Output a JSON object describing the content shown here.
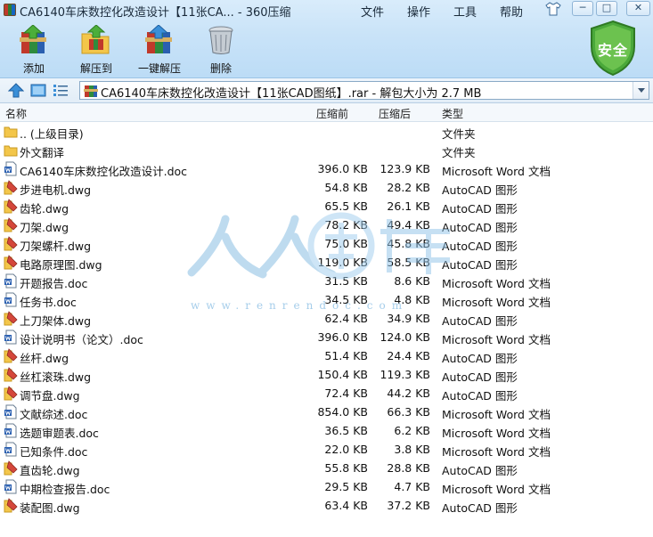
{
  "window": {
    "title": "CA6140车床数控化改造设计【11张CA... - 360压缩"
  },
  "menu": {
    "items": [
      "文件",
      "操作",
      "工具",
      "帮助"
    ]
  },
  "window_controls": {
    "minimize": "─",
    "restore": "□",
    "close": "✕"
  },
  "toolbar": {
    "add_label": "添加",
    "extract_to_label": "解压到",
    "one_click_extract_label": "一键解压",
    "delete_label": "删除",
    "security_badge": "安全"
  },
  "address_bar": {
    "path": "CA6140车床数控化改造设计【11张CAD图纸】.rar - 解包大小为 2.7 MB"
  },
  "columns": {
    "name": "名称",
    "compressed_before": "压缩前",
    "compressed_after": "压缩后",
    "type": "类型"
  },
  "watermark": {
    "url": "www.renrendoc.com"
  },
  "files": [
    {
      "name": ".. (上级目录)",
      "size_before": "",
      "size_after": "",
      "type": "文件夹",
      "icon": "folder-icon"
    },
    {
      "name": "外文翻译",
      "size_before": "",
      "size_after": "",
      "type": "文件夹",
      "icon": "folder-icon"
    },
    {
      "name": "CA6140车床数控化改造设计.doc",
      "size_before": "396.0 KB",
      "size_after": "123.9 KB",
      "type": "Microsoft Word 文档",
      "icon": "word-doc-icon"
    },
    {
      "name": "步进电机.dwg",
      "size_before": "54.8 KB",
      "size_after": "28.2 KB",
      "type": "AutoCAD 图形",
      "icon": "dwg-icon"
    },
    {
      "name": "齿轮.dwg",
      "size_before": "65.5 KB",
      "size_after": "26.1 KB",
      "type": "AutoCAD 图形",
      "icon": "dwg-icon"
    },
    {
      "name": "刀架.dwg",
      "size_before": "78.2 KB",
      "size_after": "49.4 KB",
      "type": "AutoCAD 图形",
      "icon": "dwg-icon"
    },
    {
      "name": "刀架螺杆.dwg",
      "size_before": "75.0 KB",
      "size_after": "45.8 KB",
      "type": "AutoCAD 图形",
      "icon": "dwg-icon"
    },
    {
      "name": "电路原理图.dwg",
      "size_before": "119.0 KB",
      "size_after": "58.5 KB",
      "type": "AutoCAD 图形",
      "icon": "dwg-icon"
    },
    {
      "name": "开题报告.doc",
      "size_before": "31.5 KB",
      "size_after": "8.6 KB",
      "type": "Microsoft Word 文档",
      "icon": "word-doc-icon"
    },
    {
      "name": "任务书.doc",
      "size_before": "34.5 KB",
      "size_after": "4.8 KB",
      "type": "Microsoft Word 文档",
      "icon": "word-doc-icon"
    },
    {
      "name": "上刀架体.dwg",
      "size_before": "62.4 KB",
      "size_after": "34.9 KB",
      "type": "AutoCAD 图形",
      "icon": "dwg-icon"
    },
    {
      "name": "设计说明书（论文）.doc",
      "size_before": "396.0 KB",
      "size_after": "124.0 KB",
      "type": "Microsoft Word 文档",
      "icon": "word-doc-icon"
    },
    {
      "name": "丝杆.dwg",
      "size_before": "51.4 KB",
      "size_after": "24.4 KB",
      "type": "AutoCAD 图形",
      "icon": "dwg-icon"
    },
    {
      "name": "丝杠滚珠.dwg",
      "size_before": "150.4 KB",
      "size_after": "119.3 KB",
      "type": "AutoCAD 图形",
      "icon": "dwg-icon"
    },
    {
      "name": "调节盘.dwg",
      "size_before": "72.4 KB",
      "size_after": "44.2 KB",
      "type": "AutoCAD 图形",
      "icon": "dwg-icon"
    },
    {
      "name": "文献综述.doc",
      "size_before": "854.0 KB",
      "size_after": "66.3 KB",
      "type": "Microsoft Word 文档",
      "icon": "word-doc-icon"
    },
    {
      "name": "选题审题表.doc",
      "size_before": "36.5 KB",
      "size_after": "6.2 KB",
      "type": "Microsoft Word 文档",
      "icon": "word-doc-icon"
    },
    {
      "name": "已知条件.doc",
      "size_before": "22.0 KB",
      "size_after": "3.8 KB",
      "type": "Microsoft Word 文档",
      "icon": "word-doc-icon"
    },
    {
      "name": "直齿轮.dwg",
      "size_before": "55.8 KB",
      "size_after": "28.8 KB",
      "type": "AutoCAD 图形",
      "icon": "dwg-icon"
    },
    {
      "name": "中期检查报告.doc",
      "size_before": "29.5 KB",
      "size_after": "4.7 KB",
      "type": "Microsoft Word 文档",
      "icon": "word-doc-icon"
    },
    {
      "name": "装配图.dwg",
      "size_before": "63.4 KB",
      "size_after": "37.2 KB",
      "type": "AutoCAD 图形",
      "icon": "dwg-icon"
    }
  ]
}
